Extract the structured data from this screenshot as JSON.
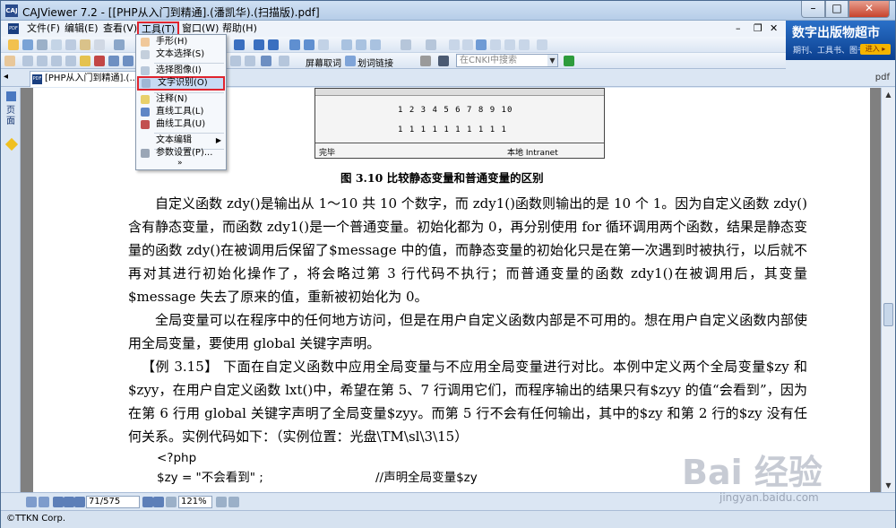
{
  "window": {
    "title": "CAJViewer 7.2 - [[PHP从入门到精通].(潘凯华).(扫描版).pdf]",
    "min": "–",
    "max": "□",
    "close": "✕"
  },
  "menu": [
    "文件(F)",
    "编辑(E)",
    "查看(V)",
    "工具(T)",
    "窗口(W)",
    "帮助(H)"
  ],
  "mdi": {
    "min": "–",
    "restore": "❐",
    "close": "✕"
  },
  "toolbar": {
    "screen_word": "屏幕取词",
    "word_link": "划词链接",
    "cnki_placeholder": "在CNKI中搜索"
  },
  "ad": {
    "title": "数字出版物超市",
    "subtitle": "期刊、工具书、图书...",
    "go": "进入 ▸"
  },
  "tab": {
    "label": "[PHP从入门到精通].(...",
    "right": "pdf"
  },
  "sidebar": {
    "label": "页面"
  },
  "dropdown": {
    "items": [
      "手形(H)",
      "文本选择(S)",
      "选择图像(I)",
      "文字识别(O)",
      "注释(N)",
      "直线工具(L)",
      "曲线工具(U)",
      "文本编辑",
      "参数设置(P)..."
    ],
    "more": "»"
  },
  "figure": {
    "row1": "1 2 3 4 5 6 7 8 9 10",
    "row2": "1 1 1 1 1 1 1 1 1 1",
    "done": "完毕",
    "intranet": "本地 Intranet",
    "caption": "图 3.10    比较静态变量和普通变量的区别"
  },
  "paragraphs": [
    "自定义函数 zdy()是输出从 1～10 共 10 个数字，而 zdy1()函数则输出的是 10 个 1。因为自定义函数 zdy()含有静态变量，而函数 zdy1()是一个普通变量。初始化都为 0，再分别使用 for 循环调用两个函数，结果是静态变量的函数 zdy()在被调用后保留了$message 中的值，而静态变量的初始化只是在第一次遇到时被执行，以后就不再对其进行初始化操作了，将会略过第 3 行代码不执行；而普通变量的函数 zdy1()在被调用后，其变量$message 失去了原来的值，重新被初始化为 0。",
    "全局变量可以在程序中的任何地方访问，但是在用户自定义函数内部是不可用的。想在用户自定义函数内部使用全局变量，要使用 global 关键字声明。",
    "【例 3.15】 下面在自定义函数中应用全局变量与不应用全局变量进行对比。本例中定义两个全局变量$zy 和$zyy，在用户自定义函数 lxt()中，希望在第 5、7 行调用它们，而程序输出的结果只有$zyy 的值“会看到”，因为在第 6 行用 global 关键字声明了全局变量$zyy。而第 5 行不会有任何输出，其中的$zy 和第 2 行的$zy 没有任何关系。实例代码如下：（实例位置：光盘\\TM\\sl\\3\\15）"
  ],
  "code": {
    "line1": "<?php",
    "line2": "$zy = \"不会看到\" ;",
    "comment": "//声明全局变量$zy"
  },
  "status": {
    "page": "71/575",
    "zoom": "121%"
  },
  "bottom": {
    "corp": "©TTKN Corp."
  },
  "watermark": {
    "text": "Bai 经验",
    "url": "jingyan.baidu.com"
  }
}
